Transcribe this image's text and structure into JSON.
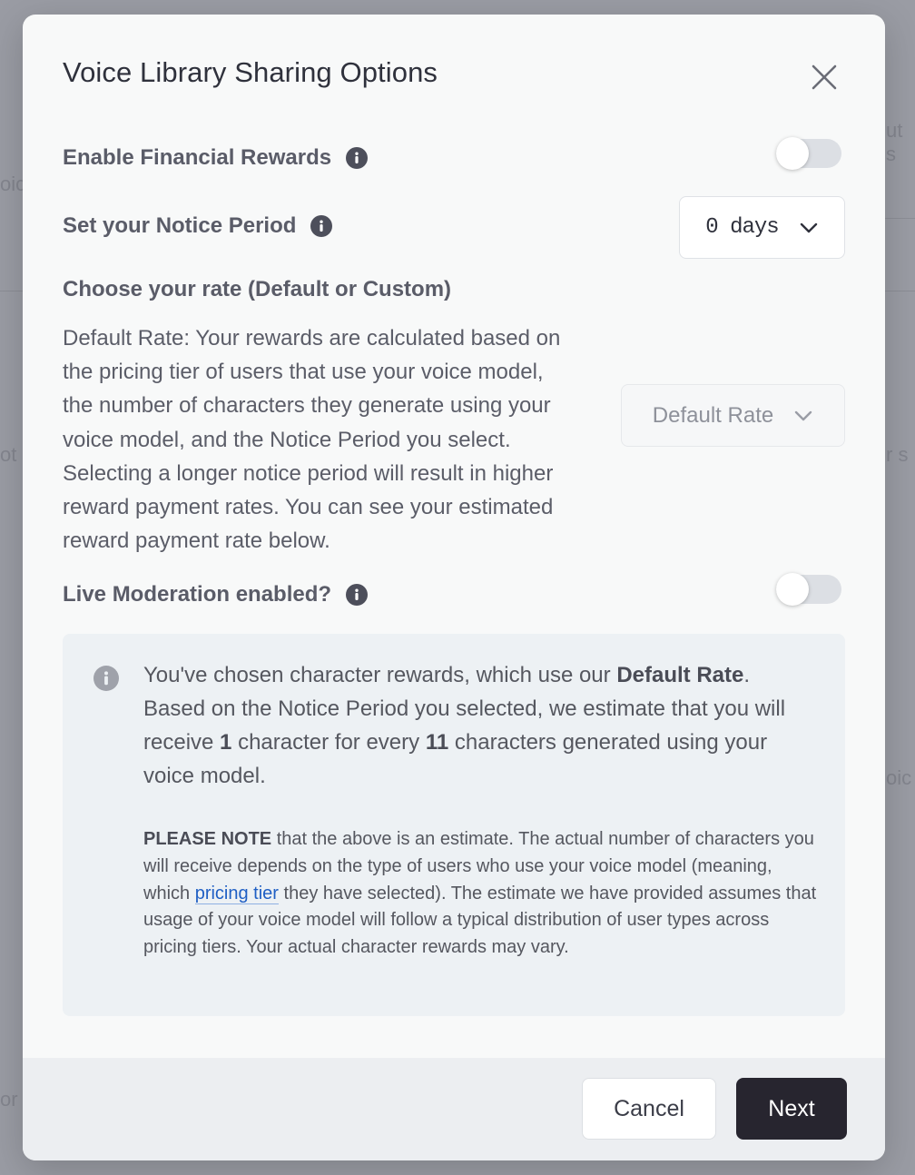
{
  "modal": {
    "title": "Voice Library Sharing Options",
    "financial_rewards": {
      "label": "Enable Financial Rewards",
      "enabled": false
    },
    "notice_period": {
      "label": "Set your Notice Period",
      "value": "0 days"
    },
    "rate": {
      "heading": "Choose your rate (Default or Custom)",
      "description": "Default Rate: Your rewards are calculated based on the pricing tier of users that use your voice model, the number of characters they generate using your voice model, and the Notice Period you select. Selecting a longer notice period will result in higher reward payment rates. You can see your estimated reward payment rate below.",
      "select_value": "Default Rate"
    },
    "live_moderation": {
      "label": "Live Moderation enabled?",
      "enabled": false
    },
    "callout": {
      "line_1": "You've chosen character rewards, which use our ",
      "rate_name": "Default Rate",
      "line_2": ". Based on the Notice Period you selected, we estimate that you will receive ",
      "receive_count": "1",
      "line_3": " character for every ",
      "every_count": "11",
      "line_4": " characters generated using your voice model.",
      "note_prefix": "PLEASE NOTE",
      "note_part_1": " that the above is an estimate. The actual number of characters you will receive depends on the type of users who use your voice model (meaning, which ",
      "note_link": "pricing tier",
      "note_part_2": " they have selected). The estimate we have provided assumes that usage of your voice model will follow a typical distribution of user types across pricing tiers. Your actual character rewards may vary."
    },
    "footer": {
      "cancel_label": "Cancel",
      "next_label": "Next"
    }
  },
  "icons": {
    "close": "close-icon",
    "info": "info-icon",
    "chevron": "chevron-down-icon"
  },
  "colors": {
    "primary_button": "#27252f",
    "link": "#1f5fc4",
    "callout_bg": "#edf1f4",
    "toggle_off": "#dcdfe4"
  }
}
